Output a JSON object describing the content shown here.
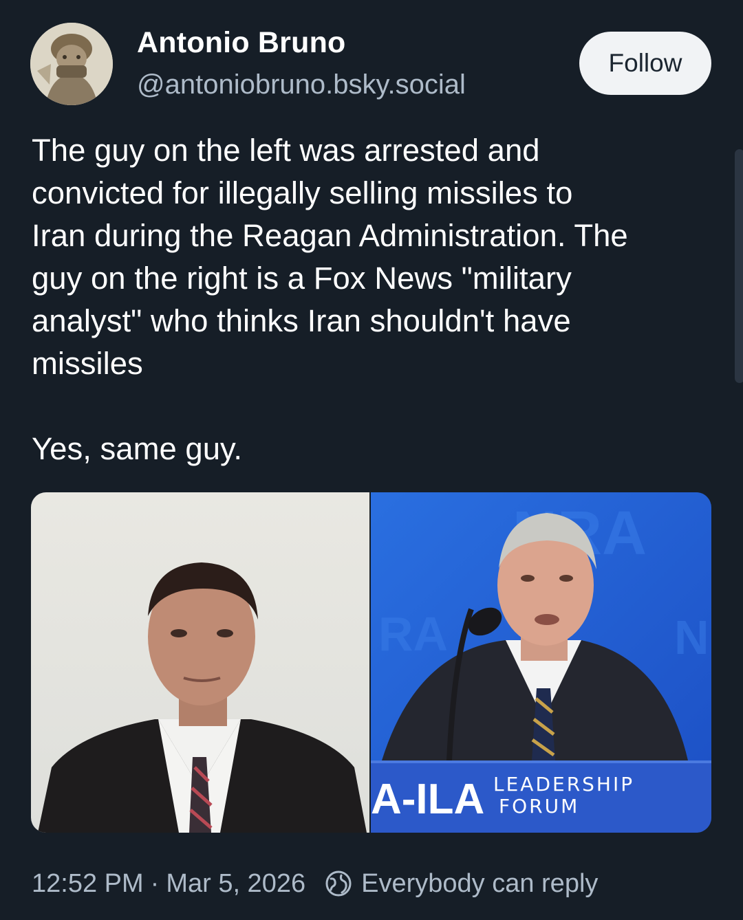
{
  "author": {
    "display_name": "Antonio Bruno",
    "handle": "@antoniobruno.bsky.social",
    "avatar_icon": "avatar-image"
  },
  "follow_button": {
    "label": "Follow"
  },
  "post": {
    "text": "The guy on the left was arrested and\nconvicted for illegally selling missiles to\nIran during the Reagan Administration. The\nguy on the right is a Fox News \"military\nanalyst\" who thinks Iran shouldn't have\nmissiles\n\nYes, same guy."
  },
  "media": {
    "left_image_icon": "photo-young-man-suit",
    "right_image_icon": "photo-older-man-podium",
    "banner": {
      "logo_text": "A-ILA",
      "line1": "LEADERSHIP",
      "line2": "FORUM"
    }
  },
  "meta": {
    "time": "12:52 PM",
    "separator": "·",
    "date": "Mar 5, 2026",
    "reply_setting": "Everybody can reply",
    "reply_icon": "globe-icon"
  },
  "colors": {
    "background": "#161e27",
    "text_primary": "#ffffff",
    "text_secondary": "#aebbc9",
    "follow_bg": "#f1f3f5",
    "banner_blue": "#2c59c9"
  }
}
